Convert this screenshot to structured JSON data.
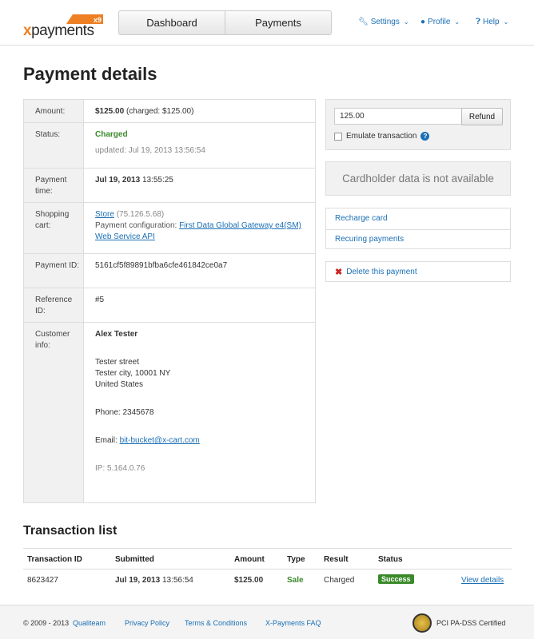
{
  "header": {
    "logo_text": "xpayments",
    "logo_badge": "x9",
    "nav": [
      "Dashboard",
      "Payments"
    ],
    "menus": [
      {
        "label": "Settings",
        "icon": "wrench-icon"
      },
      {
        "label": "Profile",
        "icon": "user-icon"
      },
      {
        "label": "Help",
        "icon": "help-icon"
      }
    ]
  },
  "page_title": "Payment details",
  "details": {
    "amount": {
      "label": "Amount:",
      "value": "$125.00",
      "charged": "(charged: $125.00)"
    },
    "status": {
      "label": "Status:",
      "value": "Charged",
      "updated": "updated: Jul 19, 2013 13:56:54"
    },
    "payment_time": {
      "label": "Payment time:",
      "date": "Jul 19, 2013",
      "time": "13:55:25"
    },
    "shopping_cart": {
      "label": "Shopping cart:",
      "store": "Store",
      "ip": "(75.126.5.68)",
      "config_label": "Payment configuration:",
      "config_link": "First Data Global Gateway e4(SM) Web Service API"
    },
    "payment_id": {
      "label": "Payment ID:",
      "value": "5161cf5f89891bfba6cfe461842ce0a7"
    },
    "reference_id": {
      "label": "Reference ID:",
      "value": "#5"
    },
    "customer": {
      "label": "Customer info:",
      "name": "Alex Tester",
      "street": "Tester street",
      "city": "Tester city, 10001 NY",
      "country": "United States",
      "phone": "Phone: 2345678",
      "email_label": "Email:",
      "email": "bit-bucket@x-cart.com",
      "ip": "IP: 5.164.0.76"
    }
  },
  "refund": {
    "amount": "125.00",
    "button": "Refund",
    "emulate_label": "Emulate transaction"
  },
  "cardholder_notice": "Cardholder data is not available",
  "actions": {
    "recharge": "Recharge card",
    "recurring": "Recuring payments",
    "delete": "Delete this payment"
  },
  "transactions": {
    "title": "Transaction list",
    "headers": [
      "Transaction ID",
      "Submitted",
      "Amount",
      "Type",
      "Result",
      "Status"
    ],
    "rows": [
      {
        "id": "8623427",
        "date": "Jul 19, 2013",
        "time": "13:56:54",
        "amount": "$125.00",
        "type": "Sale",
        "result": "Charged",
        "status": "Success",
        "link": "View details"
      }
    ]
  },
  "footer": {
    "copyright": "© 2009 - 2013",
    "company": "Qualiteam",
    "links": [
      "Privacy Policy",
      "Terms & Conditions",
      "X-Payments FAQ"
    ],
    "pci": "PCI PA-DSS Certified"
  },
  "colors": {
    "brand_orange": "#ee7f22",
    "link_blue": "#1a6fb5",
    "success_green": "#3a8a2a"
  }
}
